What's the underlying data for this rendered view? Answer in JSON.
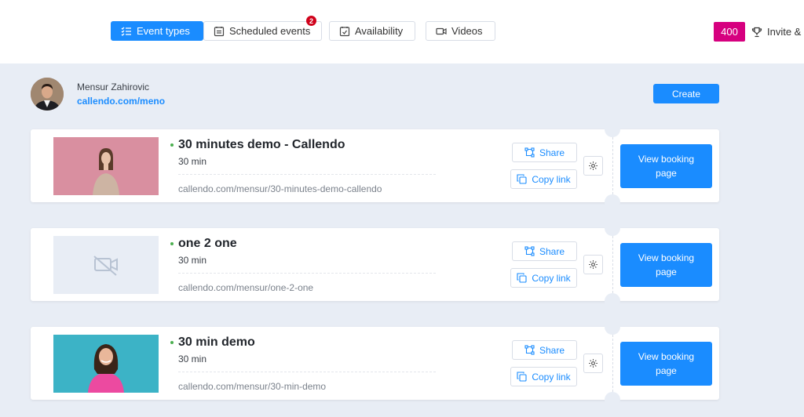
{
  "nav": {
    "tabs": [
      {
        "label": "Event types",
        "icon": "list-icon",
        "active": true
      },
      {
        "label": "Scheduled events",
        "icon": "calendar-list-icon",
        "badge": "2"
      },
      {
        "label": "Availability",
        "icon": "calendar-check-icon"
      },
      {
        "label": "Videos",
        "icon": "video-icon"
      }
    ],
    "points": "400",
    "invite_label": "Invite &"
  },
  "profile": {
    "name": "Mensur Zahirovic",
    "link": "callendo.com/meno"
  },
  "create_label": "Create",
  "colors": {
    "accent": "#1a8cff",
    "points_bg": "#d6007f",
    "badge": "#d0021b",
    "active_dot": "#4caf50",
    "page_bg": "#e8edf5"
  },
  "events": [
    {
      "title": "30 minutes demo - Callendo",
      "duration": "30 min",
      "url": "callendo.com/mensur/30-minutes-demo-callendo",
      "thumbnail": "woman-on-pink-background"
    },
    {
      "title": "one 2 one",
      "duration": "30 min",
      "url": "callendo.com/mensur/one-2-one",
      "thumbnail": "video-off-placeholder"
    },
    {
      "title": "30 min demo",
      "duration": "30 min",
      "url": "callendo.com/mensur/30-min-demo",
      "thumbnail": "woman-on-teal-background"
    }
  ],
  "card_actions": {
    "share_label": "Share",
    "copy_label": "Copy link",
    "view_label": "View booking page"
  }
}
